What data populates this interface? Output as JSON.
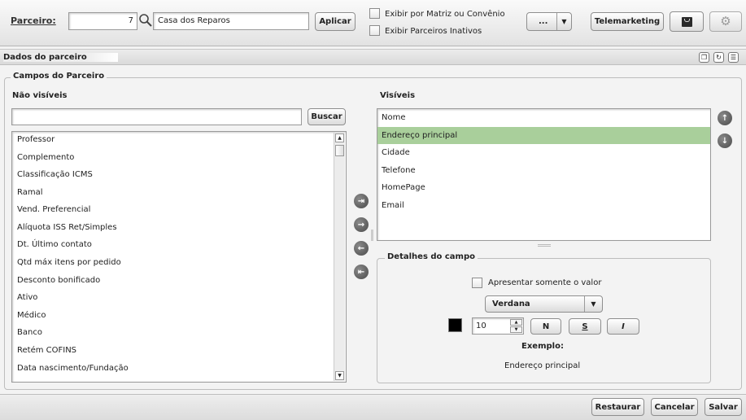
{
  "toolbar": {
    "partner_label": "Parceiro:",
    "partner_code": "7",
    "partner_name": "Casa dos Reparos",
    "apply_label": "Aplicar",
    "opt_matrix_label": "Exibir por Matriz ou Convênio",
    "opt_inactive_label": "Exibir Parceiros Inativos",
    "more_label": "...",
    "telemarketing_label": "Telemarketing"
  },
  "panel": {
    "title": "Dados do parceiro",
    "section_title": "Campos do Parceiro",
    "hidden_heading": "Não visíveis",
    "visible_heading": "Visíveis",
    "search_value": "",
    "search_label": "Buscar",
    "hidden_items": [
      "Professor",
      "Complemento",
      "Classificação ICMS",
      "Ramal",
      "Vend. Preferencial",
      "Alíquota ISS Ret/Simples",
      "Dt. Último contato",
      "Qtd máx itens por pedido",
      "Desconto bonificado",
      "Ativo",
      "Médico",
      "Banco",
      "Retém COFINS",
      "Data nascimento/Fundação"
    ],
    "visible_items": [
      "Nome",
      "Endereço principal",
      "Cidade",
      "Telefone",
      "HomePage",
      "Email"
    ],
    "selected_visible": "Endereço principal"
  },
  "details": {
    "title": "Detalhes do campo",
    "only_value_label": "Apresentar somente o valor",
    "font_name": "Verdana",
    "font_size": "10",
    "bold_label": "N",
    "underline_label": "S",
    "italic_label": "I",
    "example_label": "Exemplo:",
    "example_text": "Endereço principal",
    "color": "#000000"
  },
  "footer": {
    "restore_label": "Restaurar",
    "cancel_label": "Cancelar",
    "save_label": "Salvar"
  },
  "colors": {
    "selection": "#a9cf9b",
    "move_button": "#555555"
  }
}
